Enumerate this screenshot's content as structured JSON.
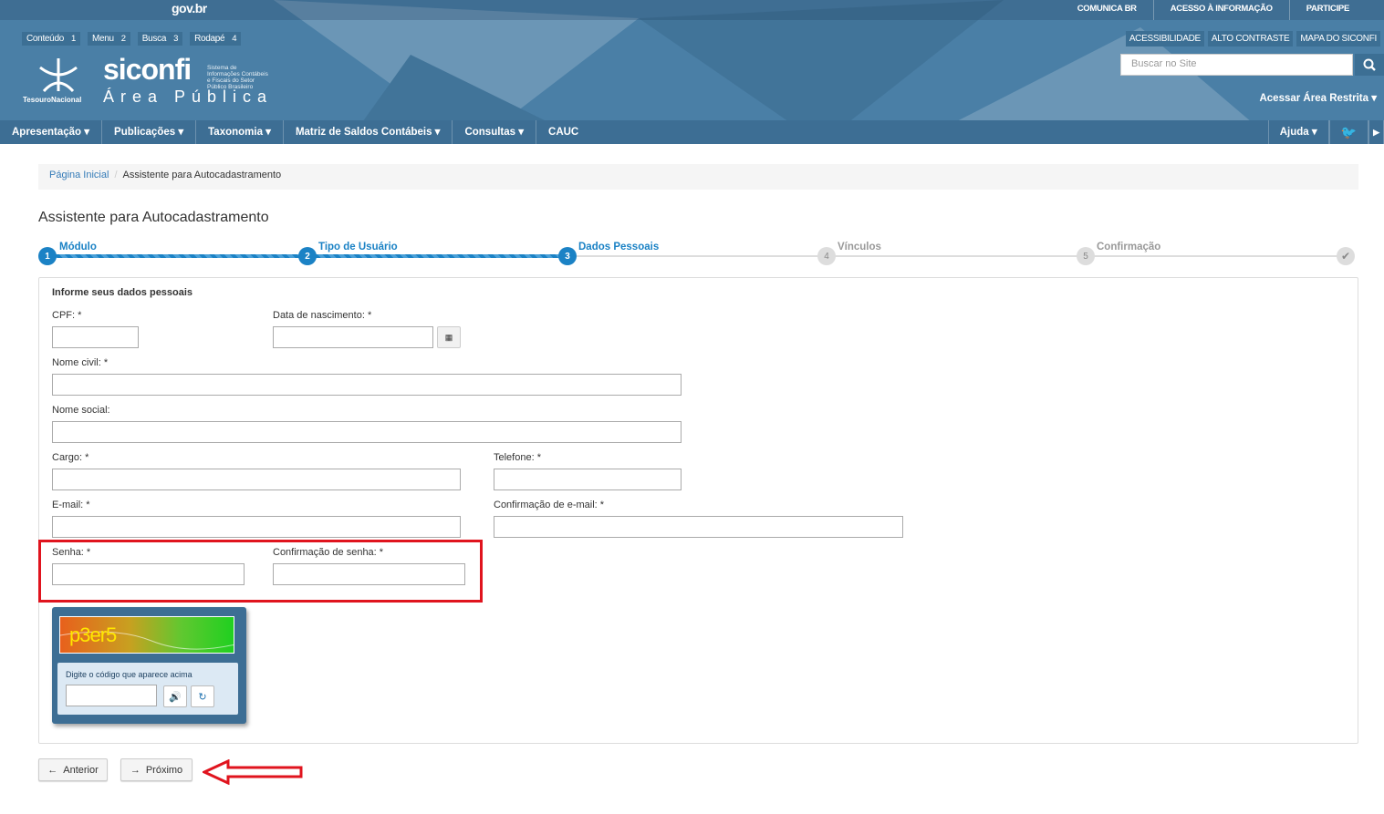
{
  "topbar": {
    "brand": "gov.br",
    "links": [
      "COMUNICA BR",
      "ACESSO À INFORMAÇÃO",
      "PARTICIPE"
    ]
  },
  "accessibility_shortcuts": [
    {
      "label": "Conteúdo",
      "key": "1"
    },
    {
      "label": "Menu",
      "key": "2"
    },
    {
      "label": "Busca",
      "key": "3"
    },
    {
      "label": "Rodapé",
      "key": "4"
    }
  ],
  "branding": {
    "org": "TesouroNacional",
    "app_name": "siconfi",
    "app_subtitle": "Sistema de Informações Contábeis e Fiscais do Setor Público Brasileiro",
    "area": "Área Pública"
  },
  "header_right": {
    "buttons": [
      "ACESSIBILIDADE",
      "ALTO CONTRASTE",
      "MAPA DO SICONFI"
    ],
    "search_placeholder": "Buscar no Site",
    "restricted": "Acessar Área Restrita"
  },
  "nav": {
    "items": [
      "Apresentação",
      "Publicações",
      "Taxonomia",
      "Matriz de Saldos Contábeis",
      "Consultas",
      "CAUC"
    ],
    "help": "Ajuda"
  },
  "breadcrumb": {
    "home": "Página Inicial",
    "current": "Assistente para Autocadastramento"
  },
  "page_title": "Assistente para Autocadastramento",
  "steps": [
    {
      "num": "1",
      "label": "Módulo",
      "state": "done"
    },
    {
      "num": "2",
      "label": "Tipo de Usuário",
      "state": "done"
    },
    {
      "num": "3",
      "label": "Dados Pessoais",
      "state": "done"
    },
    {
      "num": "4",
      "label": "Vínculos",
      "state": "todo"
    },
    {
      "num": "5",
      "label": "Confirmação",
      "state": "todo"
    }
  ],
  "form": {
    "section_title": "Informe seus dados pessoais",
    "cpf_label": "CPF: *",
    "birth_label": "Data de nascimento: *",
    "civil_name_label": "Nome civil: *",
    "social_name_label": "Nome social:",
    "role_label": "Cargo: *",
    "phone_label": "Telefone: *",
    "email_label": "E-mail: *",
    "email_confirm_label": "Confirmação de e-mail: *",
    "password_label": "Senha: *",
    "password_confirm_label": "Confirmação de senha: *"
  },
  "captcha": {
    "code": "p3er5",
    "instruction": "Digite o código que aparece acima"
  },
  "buttons": {
    "previous": "Anterior",
    "next": "Próximo"
  },
  "colors": {
    "header_bg": "#4a7fa6",
    "nav_bg": "#3d6e94",
    "step_active": "#1b82c5",
    "highlight": "#e0141e"
  }
}
